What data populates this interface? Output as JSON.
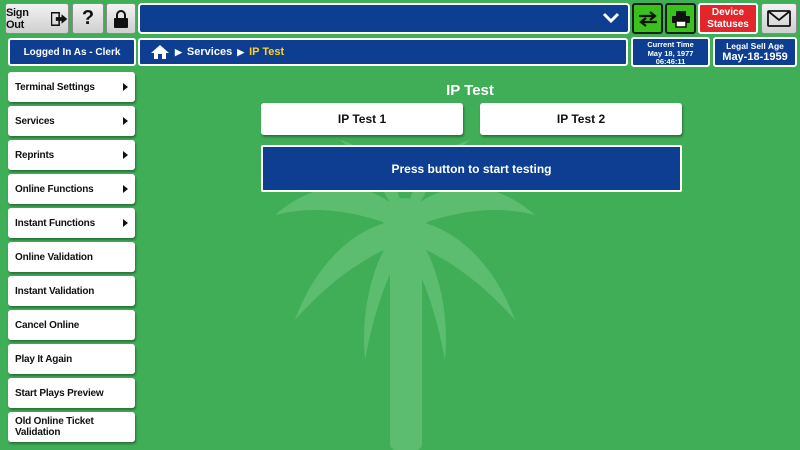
{
  "header": {
    "sign_out_label": "Sign Out",
    "help_label": "?",
    "device_statuses_label": "Device Statuses",
    "logged_in_label": "Logged In As - Clerk"
  },
  "breadcrumb": {
    "items": [
      "Services",
      "IP Test"
    ]
  },
  "current_time": {
    "label": "Current Time",
    "date": "May 18, 1977",
    "time": "06:46:11"
  },
  "legal_sell_age": {
    "label": "Legal Sell Age",
    "date": "May-18-1959"
  },
  "sidebar": {
    "items": [
      {
        "label": "Terminal Settings",
        "has_submenu": true
      },
      {
        "label": "Services",
        "has_submenu": true
      },
      {
        "label": "Reprints",
        "has_submenu": true
      },
      {
        "label": "Online Functions",
        "has_submenu": true
      },
      {
        "label": "Instant Functions",
        "has_submenu": true
      },
      {
        "label": "Online Validation",
        "has_submenu": false
      },
      {
        "label": "Instant Validation",
        "has_submenu": false
      },
      {
        "label": "Cancel Online",
        "has_submenu": false
      },
      {
        "label": "Play It Again",
        "has_submenu": false
      },
      {
        "label": "Start Plays Preview",
        "has_submenu": false
      },
      {
        "label": "Old Online Ticket Validation",
        "has_submenu": false
      }
    ]
  },
  "main": {
    "title": "IP Test",
    "buttons": [
      "IP Test 1",
      "IP Test 2"
    ],
    "status_message": "Press button to start testing"
  },
  "colors": {
    "background": "#3fae57",
    "navy": "#0d3e91",
    "accent_green": "#39c21c",
    "alert_red": "#e4262b",
    "breadcrumb_current": "#ffd21f"
  },
  "icons": [
    "sign-out-arrow-icon",
    "lock-icon",
    "chevron-down-icon",
    "transfer-arrows-icon",
    "printer-icon",
    "envelope-icon",
    "home-icon",
    "palm-tree-watermark"
  ]
}
